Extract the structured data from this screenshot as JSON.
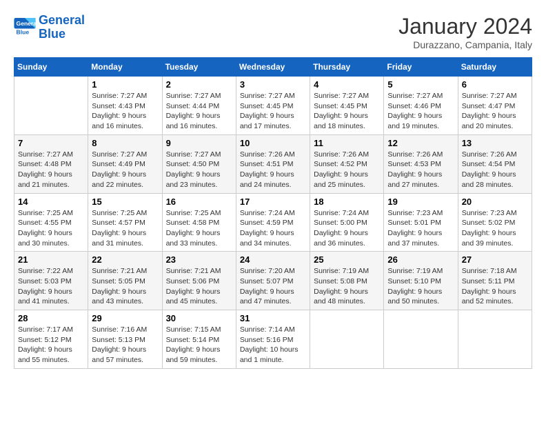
{
  "header": {
    "logo_line1": "General",
    "logo_line2": "Blue",
    "month_title": "January 2024",
    "subtitle": "Durazzano, Campania, Italy"
  },
  "weekdays": [
    "Sunday",
    "Monday",
    "Tuesday",
    "Wednesday",
    "Thursday",
    "Friday",
    "Saturday"
  ],
  "weeks": [
    [
      {
        "day": "",
        "info": ""
      },
      {
        "day": "1",
        "info": "Sunrise: 7:27 AM\nSunset: 4:43 PM\nDaylight: 9 hours\nand 16 minutes."
      },
      {
        "day": "2",
        "info": "Sunrise: 7:27 AM\nSunset: 4:44 PM\nDaylight: 9 hours\nand 16 minutes."
      },
      {
        "day": "3",
        "info": "Sunrise: 7:27 AM\nSunset: 4:45 PM\nDaylight: 9 hours\nand 17 minutes."
      },
      {
        "day": "4",
        "info": "Sunrise: 7:27 AM\nSunset: 4:45 PM\nDaylight: 9 hours\nand 18 minutes."
      },
      {
        "day": "5",
        "info": "Sunrise: 7:27 AM\nSunset: 4:46 PM\nDaylight: 9 hours\nand 19 minutes."
      },
      {
        "day": "6",
        "info": "Sunrise: 7:27 AM\nSunset: 4:47 PM\nDaylight: 9 hours\nand 20 minutes."
      }
    ],
    [
      {
        "day": "7",
        "info": "Sunrise: 7:27 AM\nSunset: 4:48 PM\nDaylight: 9 hours\nand 21 minutes."
      },
      {
        "day": "8",
        "info": "Sunrise: 7:27 AM\nSunset: 4:49 PM\nDaylight: 9 hours\nand 22 minutes."
      },
      {
        "day": "9",
        "info": "Sunrise: 7:27 AM\nSunset: 4:50 PM\nDaylight: 9 hours\nand 23 minutes."
      },
      {
        "day": "10",
        "info": "Sunrise: 7:26 AM\nSunset: 4:51 PM\nDaylight: 9 hours\nand 24 minutes."
      },
      {
        "day": "11",
        "info": "Sunrise: 7:26 AM\nSunset: 4:52 PM\nDaylight: 9 hours\nand 25 minutes."
      },
      {
        "day": "12",
        "info": "Sunrise: 7:26 AM\nSunset: 4:53 PM\nDaylight: 9 hours\nand 27 minutes."
      },
      {
        "day": "13",
        "info": "Sunrise: 7:26 AM\nSunset: 4:54 PM\nDaylight: 9 hours\nand 28 minutes."
      }
    ],
    [
      {
        "day": "14",
        "info": "Sunrise: 7:25 AM\nSunset: 4:55 PM\nDaylight: 9 hours\nand 30 minutes."
      },
      {
        "day": "15",
        "info": "Sunrise: 7:25 AM\nSunset: 4:57 PM\nDaylight: 9 hours\nand 31 minutes."
      },
      {
        "day": "16",
        "info": "Sunrise: 7:25 AM\nSunset: 4:58 PM\nDaylight: 9 hours\nand 33 minutes."
      },
      {
        "day": "17",
        "info": "Sunrise: 7:24 AM\nSunset: 4:59 PM\nDaylight: 9 hours\nand 34 minutes."
      },
      {
        "day": "18",
        "info": "Sunrise: 7:24 AM\nSunset: 5:00 PM\nDaylight: 9 hours\nand 36 minutes."
      },
      {
        "day": "19",
        "info": "Sunrise: 7:23 AM\nSunset: 5:01 PM\nDaylight: 9 hours\nand 37 minutes."
      },
      {
        "day": "20",
        "info": "Sunrise: 7:23 AM\nSunset: 5:02 PM\nDaylight: 9 hours\nand 39 minutes."
      }
    ],
    [
      {
        "day": "21",
        "info": "Sunrise: 7:22 AM\nSunset: 5:03 PM\nDaylight: 9 hours\nand 41 minutes."
      },
      {
        "day": "22",
        "info": "Sunrise: 7:21 AM\nSunset: 5:05 PM\nDaylight: 9 hours\nand 43 minutes."
      },
      {
        "day": "23",
        "info": "Sunrise: 7:21 AM\nSunset: 5:06 PM\nDaylight: 9 hours\nand 45 minutes."
      },
      {
        "day": "24",
        "info": "Sunrise: 7:20 AM\nSunset: 5:07 PM\nDaylight: 9 hours\nand 47 minutes."
      },
      {
        "day": "25",
        "info": "Sunrise: 7:19 AM\nSunset: 5:08 PM\nDaylight: 9 hours\nand 48 minutes."
      },
      {
        "day": "26",
        "info": "Sunrise: 7:19 AM\nSunset: 5:10 PM\nDaylight: 9 hours\nand 50 minutes."
      },
      {
        "day": "27",
        "info": "Sunrise: 7:18 AM\nSunset: 5:11 PM\nDaylight: 9 hours\nand 52 minutes."
      }
    ],
    [
      {
        "day": "28",
        "info": "Sunrise: 7:17 AM\nSunset: 5:12 PM\nDaylight: 9 hours\nand 55 minutes."
      },
      {
        "day": "29",
        "info": "Sunrise: 7:16 AM\nSunset: 5:13 PM\nDaylight: 9 hours\nand 57 minutes."
      },
      {
        "day": "30",
        "info": "Sunrise: 7:15 AM\nSunset: 5:14 PM\nDaylight: 9 hours\nand 59 minutes."
      },
      {
        "day": "31",
        "info": "Sunrise: 7:14 AM\nSunset: 5:16 PM\nDaylight: 10 hours\nand 1 minute."
      },
      {
        "day": "",
        "info": ""
      },
      {
        "day": "",
        "info": ""
      },
      {
        "day": "",
        "info": ""
      }
    ]
  ]
}
